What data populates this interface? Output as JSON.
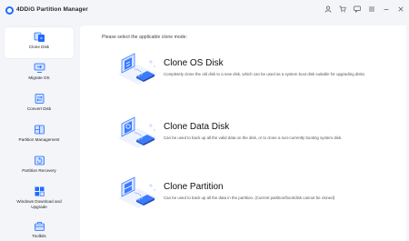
{
  "window": {
    "title": "4DDiG Partition Manager"
  },
  "titlebar_icons": [
    "user-icon",
    "cart-icon",
    "feedback-icon",
    "menu-icon",
    "minimize-icon",
    "close-icon"
  ],
  "sidebar": {
    "items": [
      {
        "label": "Clone Disk",
        "icon": "clone-disk-icon",
        "active": true
      },
      {
        "label": "Migrate OS",
        "icon": "migrate-os-icon",
        "active": false
      },
      {
        "label": "Convert Disk",
        "icon": "convert-disk-icon",
        "active": false
      },
      {
        "label": "Partition Management",
        "icon": "partition-management-icon",
        "active": false
      },
      {
        "label": "Partition Recovery",
        "icon": "partition-recovery-icon",
        "active": false
      },
      {
        "label": "Windows Download and Upgrade",
        "icon": "windows-download-icon",
        "active": false
      },
      {
        "label": "Toolkits",
        "icon": "toolkits-icon",
        "active": false
      }
    ]
  },
  "main": {
    "prompt": "Please select the applicable clone mode:",
    "cards": [
      {
        "title": "Clone OS Disk",
        "description": "Completely clone the old disk to a new disk, which can be used as a system boot disk suitable for upgrading disks."
      },
      {
        "title": "Clone Data Disk",
        "description": "Can be used to back up all the valid data on the disk, or to clone a non-currently booting system disk."
      },
      {
        "title": "Clone Partition",
        "description": "Can be used to back up all the data in the partition. (Current partition/boot/disk cannot be cloned)"
      }
    ]
  },
  "colors": {
    "accent": "#1f6bff",
    "illustration": "#3a7bff",
    "background": "#f3f5f9",
    "panel": "#ffffff"
  }
}
